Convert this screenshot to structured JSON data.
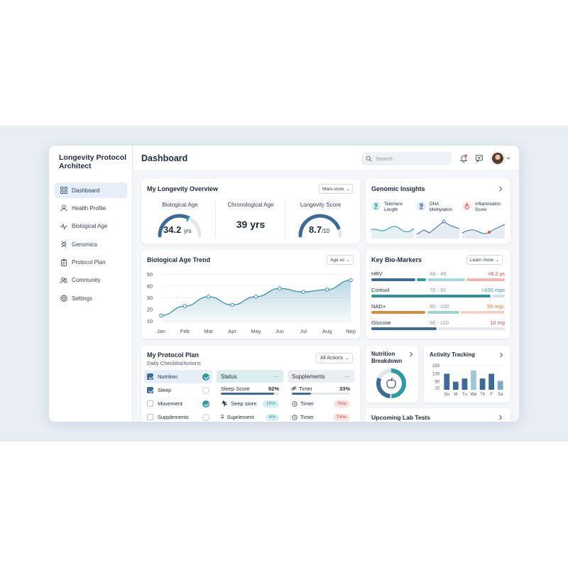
{
  "app": {
    "title": "Longevity Protocol Architect"
  },
  "sidebar": {
    "items": [
      {
        "label": "Dashboard",
        "icon": "grid-icon",
        "active": true
      },
      {
        "label": "Health Profile",
        "icon": "user-icon"
      },
      {
        "label": "Biological Age",
        "icon": "pulse-icon"
      },
      {
        "label": "Genomics",
        "icon": "dna-icon"
      },
      {
        "label": "Protocol Plan",
        "icon": "clipboard-icon"
      },
      {
        "label": "Community",
        "icon": "users-icon"
      },
      {
        "label": "Settings",
        "icon": "gear-icon"
      }
    ]
  },
  "header": {
    "title": "Dashboard",
    "search_placeholder": "Search",
    "icons": [
      "bell-icon",
      "message-icon",
      "avatar"
    ]
  },
  "overview": {
    "title": "My Longevity Overview",
    "dropdown": "Main store",
    "biological_age": {
      "label": "Biological Age",
      "value": "34.2",
      "unit": "yrs",
      "fraction": 0.62
    },
    "chronological_age": {
      "label": "Chronological Age",
      "value": "39 yrs"
    },
    "longevity_score": {
      "label": "Longevity Score",
      "value": "8.7",
      "unit": "/10",
      "fraction": 0.87
    }
  },
  "genomic": {
    "title": "Genomic Insights",
    "items": [
      {
        "label": "Telomere Length",
        "icon": "hourglass-icon",
        "color": "#2f9aa0"
      },
      {
        "label": "DNA Methylation",
        "icon": "hourglass-icon",
        "color": "#3d6b95"
      },
      {
        "label": "Inflammation Score",
        "icon": "flame-icon",
        "color": "#d9534f"
      }
    ]
  },
  "trend": {
    "title": "Biological Age Trend",
    "dropdown": "Age vs"
  },
  "chart_data": {
    "type": "line",
    "categories": [
      "Jan",
      "Feb",
      "Mar",
      "Apr",
      "May",
      "Jun",
      "Jul",
      "Aug",
      "Nep"
    ],
    "values": [
      15,
      23,
      31,
      24,
      31,
      38,
      35,
      37,
      45
    ],
    "yticks": [
      "50",
      "40",
      "30",
      "20",
      "10"
    ],
    "ylim": [
      8,
      52
    ],
    "color": "#3d8fa8"
  },
  "biomarkers": {
    "title": "Key Bio-Markers",
    "dropdown": "Learn more",
    "rows": [
      {
        "name": "HRV",
        "range": "48 - 48",
        "value": "<8.2 ys",
        "value_color": "#c0504d"
      },
      {
        "name": "Cortisol",
        "range": "70 - 92",
        "value": ">100 mps",
        "value_color": "#2f8f9a"
      },
      {
        "name": "NAD+",
        "range": "80 - 100",
        "value": "50 mgL",
        "value_color": "#c97a2b"
      },
      {
        "name": "Glucose",
        "range": "90 - 110",
        "value": "10 mg",
        "value_color": "#c0504d"
      }
    ]
  },
  "plan": {
    "title": "My Protocol Plan",
    "subtitle": "Daily Checklist/Actions",
    "dropdown": "All Actions",
    "checklist": [
      {
        "label": "Nutrition",
        "checked": true,
        "done": true
      },
      {
        "label": "Sleep",
        "checked": true,
        "done": false
      },
      {
        "label": "Movement",
        "checked": false,
        "done": true
      },
      {
        "label": "Supplements",
        "checked": false,
        "done": false
      }
    ],
    "status": {
      "header": "Status",
      "sleep_score_label": "Sleep Score",
      "sleep_score_value": "92%",
      "sleep_score_fraction": 0.92,
      "rows": [
        {
          "label": "Seep store",
          "tag": "10%",
          "icon": "run-icon"
        },
        {
          "label": "Suprlement",
          "tag": "6%",
          "icon": "hourglass-icon"
        }
      ]
    },
    "supplements": {
      "header": "Supplements",
      "rows": [
        {
          "label": "Timer",
          "tag": "33%",
          "icon": "link-icon",
          "bar_fraction": 0.33
        },
        {
          "label": "Timer",
          "tag": "0me",
          "icon": "clock-icon"
        },
        {
          "label": "Timer",
          "tag": "Time",
          "icon": "clock-icon"
        }
      ]
    }
  },
  "nutrition": {
    "title": "Nutrition Breakdown",
    "icon": "apple-icon"
  },
  "activity": {
    "title": "Activity Tracking",
    "yticks": [
      "150",
      "100",
      "50",
      "10"
    ],
    "days": [
      "Su",
      "M",
      "Tu",
      "We",
      "Th",
      "F",
      "Sa"
    ],
    "values": [
      100,
      50,
      70,
      120,
      70,
      100,
      55
    ]
  },
  "labs": {
    "title": "Upcoming Lab Tests"
  }
}
